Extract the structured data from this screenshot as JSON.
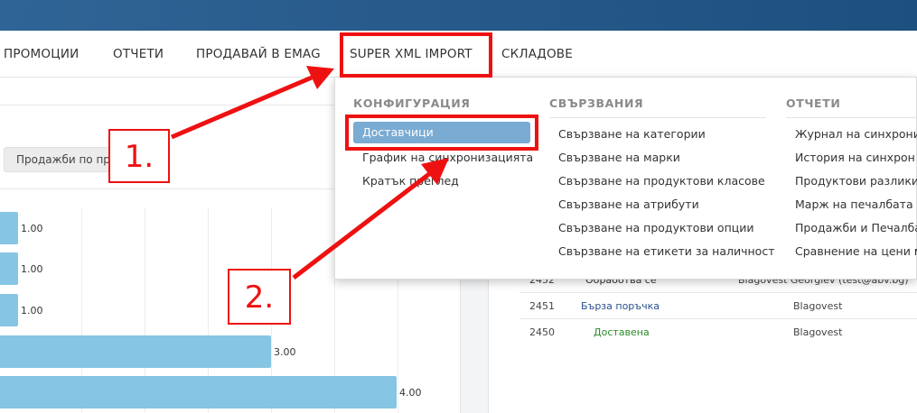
{
  "nav": {
    "promotions": "ПРОМОЦИИ",
    "reports": "ОТЧЕТИ",
    "sell_emag": "ПРОДАВАЙ В EMAG",
    "super_xml": "SUPER XML IMPORT",
    "warehouses": "СКЛАДОВЕ"
  },
  "left": {
    "sales_button": "Продажби по пр",
    "bars": [
      "1.00",
      "1.00",
      "1.00",
      "3.00",
      "4.00"
    ]
  },
  "orders": [
    {
      "id": "2452",
      "status": "Обработва се",
      "customer": "Blagovest Georgiev (test@abv.bg)"
    },
    {
      "id": "2451",
      "status": "Бърза поръчка",
      "customer": "Blagovest"
    },
    {
      "id": "2450",
      "status": "Доставена",
      "customer": "Blagovest"
    }
  ],
  "dropdown": {
    "config": {
      "heading": "КОНФИГУРАЦИЯ",
      "items": [
        "Доставчици",
        "График на синхронизацията",
        "Кратък преглед"
      ]
    },
    "links": {
      "heading": "СВЪРЗВАНИЯ",
      "items": [
        "Свързване на категории",
        "Свързване на марки",
        "Свързване на продуктови класове",
        "Свързване на атрибути",
        "Свързване на продуктови опции",
        "Свързване на етикети за наличност"
      ]
    },
    "reports": {
      "heading": "ОТЧЕТИ",
      "items": [
        "Журнал на синхрониз",
        "История на синхрон",
        "Продуктови разлики",
        "Марж на печалбата",
        "Продажби и Печалба",
        "Сравнение на цени ме"
      ]
    }
  },
  "annotations": {
    "step1": "1.",
    "step2": "2."
  },
  "colors": {
    "topbar": "#2f6596",
    "bar": "#86c5e4",
    "active_item": "#7aabd2",
    "annotation": "#ee1111",
    "status_link": "#2a4f8f",
    "status_delivered": "#2a8a2a"
  }
}
